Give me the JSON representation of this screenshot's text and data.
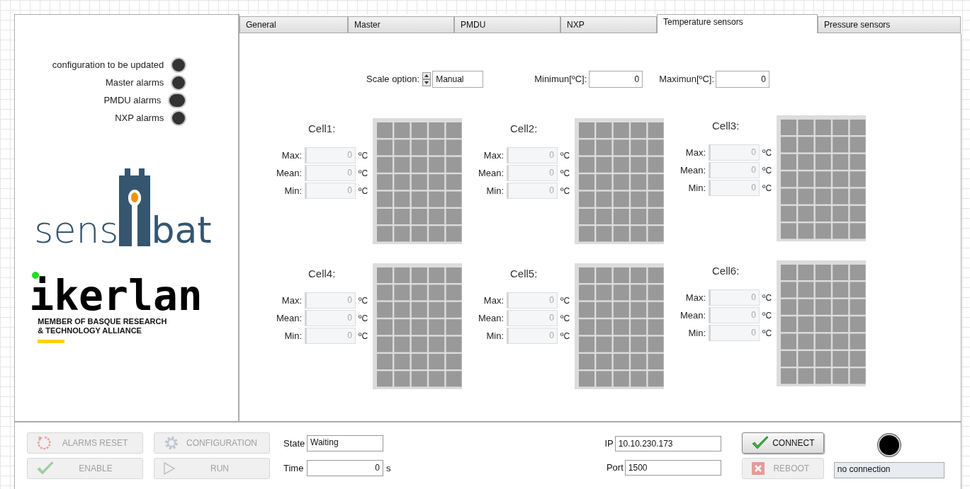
{
  "indicators": [
    {
      "label": "configuration to be updated",
      "on": false
    },
    {
      "label": "Master alarms",
      "on": false
    },
    {
      "label": "PMDU alarms",
      "on": false
    },
    {
      "label": "NXP alarms",
      "on": false
    }
  ],
  "logos": {
    "sensibat": [
      "sens",
      "bat"
    ],
    "ikerlan": "ikerlan",
    "tagline": [
      "MEMBER OF BASQUE RESEARCH",
      "& TECHNOLOGY ALLIANCE"
    ]
  },
  "tabs": [
    {
      "label": "General",
      "selected": false
    },
    {
      "label": "Master",
      "selected": false
    },
    {
      "label": "PMDU",
      "selected": false
    },
    {
      "label": "NXP",
      "selected": false
    },
    {
      "label": "Temperature sensors",
      "selected": true
    },
    {
      "label": "Pressure sensors",
      "selected": false
    }
  ],
  "scale": {
    "label": "Scale option:",
    "value": "Manual",
    "minimum_label": "Minimun[ºC]:",
    "minimum": "0",
    "maximum_label": "Maximun[ºC]:",
    "maximum": "0"
  },
  "cells": [
    {
      "title": "Cell1:",
      "stats": [
        {
          "label": "Max:",
          "value": "0",
          "unit": "ºC"
        },
        {
          "label": "Mean:",
          "value": "0",
          "unit": "ºC"
        },
        {
          "label": "Min:",
          "value": "0",
          "unit": "ºC"
        }
      ]
    },
    {
      "title": "Cell2:",
      "stats": [
        {
          "label": "Max:",
          "value": "0",
          "unit": "ºC"
        },
        {
          "label": "Mean:",
          "value": "0",
          "unit": "ºC"
        },
        {
          "label": "Min:",
          "value": "0",
          "unit": "ºC"
        }
      ]
    },
    {
      "title": "Cell3:",
      "stats": [
        {
          "label": "Max:",
          "value": "0",
          "unit": "ºC"
        },
        {
          "label": "Mean:",
          "value": "0",
          "unit": "ºC"
        },
        {
          "label": "Min:",
          "value": "0",
          "unit": "ºC"
        }
      ]
    },
    {
      "title": "Cell4:",
      "stats": [
        {
          "label": "Max:",
          "value": "0",
          "unit": "ºC"
        },
        {
          "label": "Mean:",
          "value": "0",
          "unit": "ºC"
        },
        {
          "label": "Min:",
          "value": "0",
          "unit": "ºC"
        }
      ]
    },
    {
      "title": "Cell5:",
      "stats": [
        {
          "label": "Max:",
          "value": "0",
          "unit": "ºC"
        },
        {
          "label": "Mean:",
          "value": "0",
          "unit": "ºC"
        },
        {
          "label": "Min:",
          "value": "0",
          "unit": "ºC"
        }
      ]
    },
    {
      "title": "Cell6:",
      "stats": [
        {
          "label": "Max:",
          "value": "0",
          "unit": "ºC"
        },
        {
          "label": "Mean:",
          "value": "0",
          "unit": "ºC"
        },
        {
          "label": "Min:",
          "value": "0",
          "unit": "ºC"
        }
      ]
    }
  ],
  "buttons": [
    {
      "label": "ALARMS RESET",
      "kind": "reset",
      "disabled": true
    },
    {
      "label": "CONFIGURATION",
      "kind": "gear",
      "disabled": true
    },
    {
      "label": "ENABLE",
      "kind": "check",
      "disabled": true
    },
    {
      "label": "RUN",
      "kind": "play",
      "disabled": true
    }
  ],
  "state": {
    "label": "State",
    "value": "Waiting"
  },
  "time": {
    "label": "Time",
    "value": "0",
    "unit": "s"
  },
  "ip": {
    "label": "IP",
    "value": "10.10.230.173"
  },
  "port": {
    "label": "Port",
    "value": "1500"
  },
  "connect": {
    "label": "CONNECT",
    "kind": "check",
    "disabled": false
  },
  "reboot": {
    "label": "REBOOT",
    "kind": "cross",
    "disabled": true
  },
  "connection": {
    "on": false,
    "status": "no connection"
  }
}
